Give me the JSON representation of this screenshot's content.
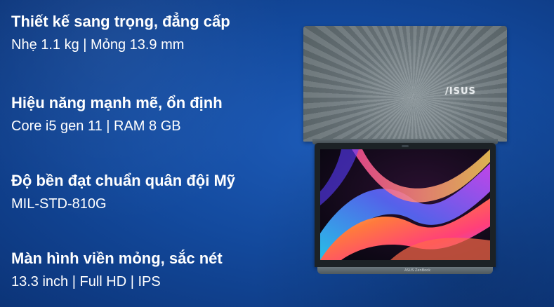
{
  "features": [
    {
      "title": "Thiết kế sang trọng, đẳng cấp",
      "detail": "Nhẹ 1.1 kg  |  Mỏng 13.9 mm"
    },
    {
      "title": "Hiệu năng mạnh mẽ, ổn định",
      "detail": "Core i5 gen 11  |  RAM 8 GB"
    },
    {
      "title": "Độ bền đạt chuẩn quân đội Mỹ",
      "detail": "MIL-STD-810G"
    },
    {
      "title": "Màn hình viền mỏng, sắc nét",
      "detail": "13.3 inch  |  Full HD  |  IPS"
    }
  ],
  "laptop": {
    "lid_logo": "/ISUS",
    "base_logo": "ASUS ZenBook"
  },
  "colors": {
    "background": "#134a9e",
    "text": "#ffffff",
    "lid": "#6c777c"
  }
}
